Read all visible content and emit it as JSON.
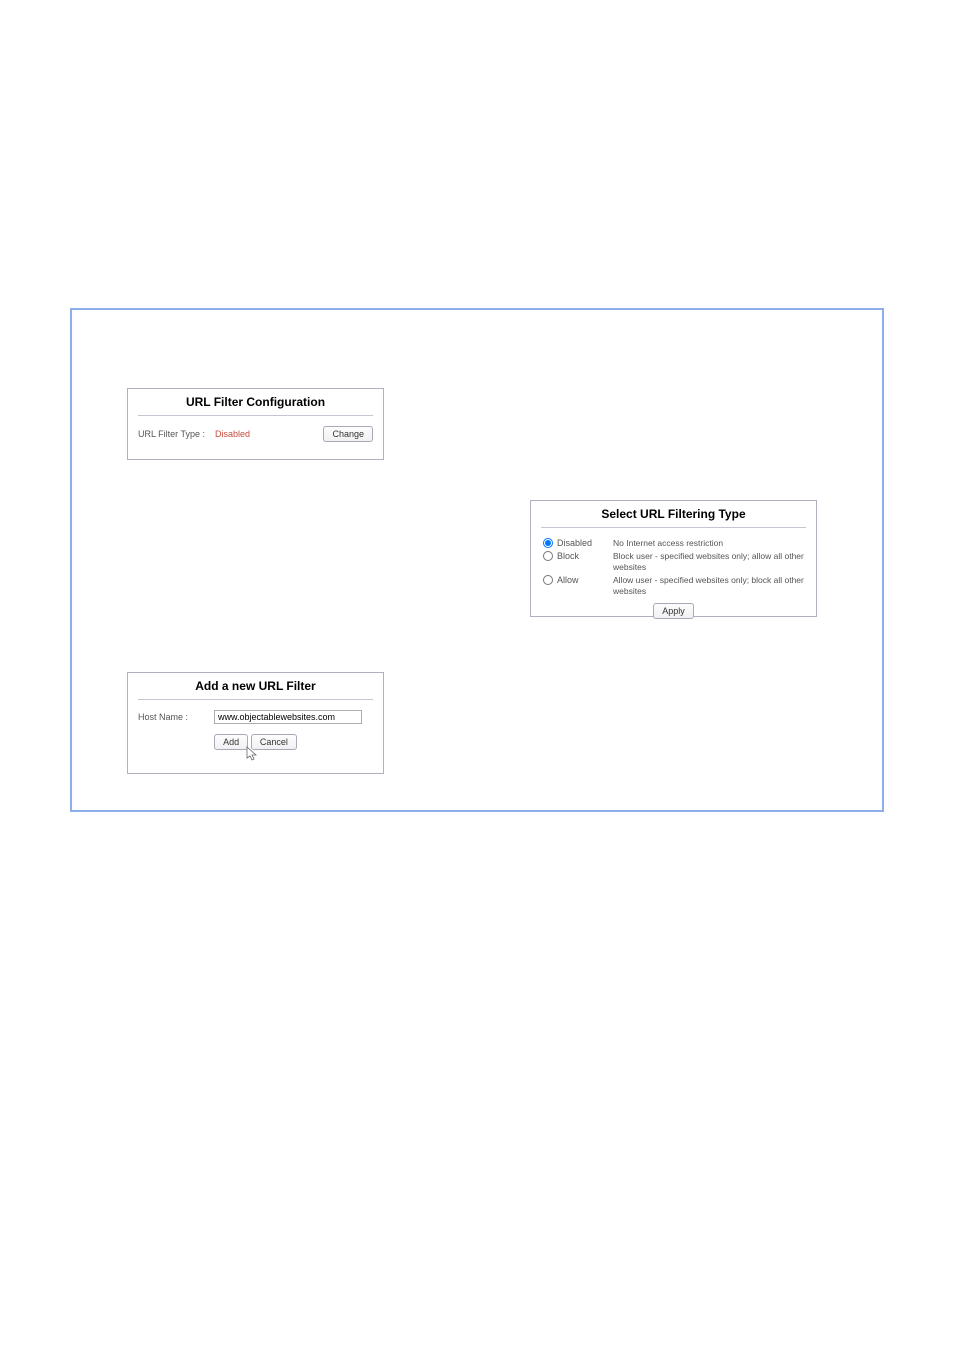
{
  "panel1": {
    "title": "URL Filter Configuration",
    "label": "URL Filter Type :",
    "value": "Disabled",
    "change_btn": "Change"
  },
  "panel2": {
    "title": "Select URL Filtering Type",
    "opts": [
      {
        "label": "Disabled",
        "desc": "No Internet access restriction",
        "checked": true
      },
      {
        "label": "Block",
        "desc": "Block user - specified websites only; allow all other websites",
        "checked": false
      },
      {
        "label": "Allow",
        "desc": "Allow user - specified websites only; block all other websites",
        "checked": false
      }
    ],
    "apply_btn": "Apply"
  },
  "panel3": {
    "title": "Add a new URL Filter",
    "label": "Host Name :",
    "input_value": "www.objectablewebsites.com",
    "add_btn": "Add",
    "cancel_btn": "Cancel"
  }
}
